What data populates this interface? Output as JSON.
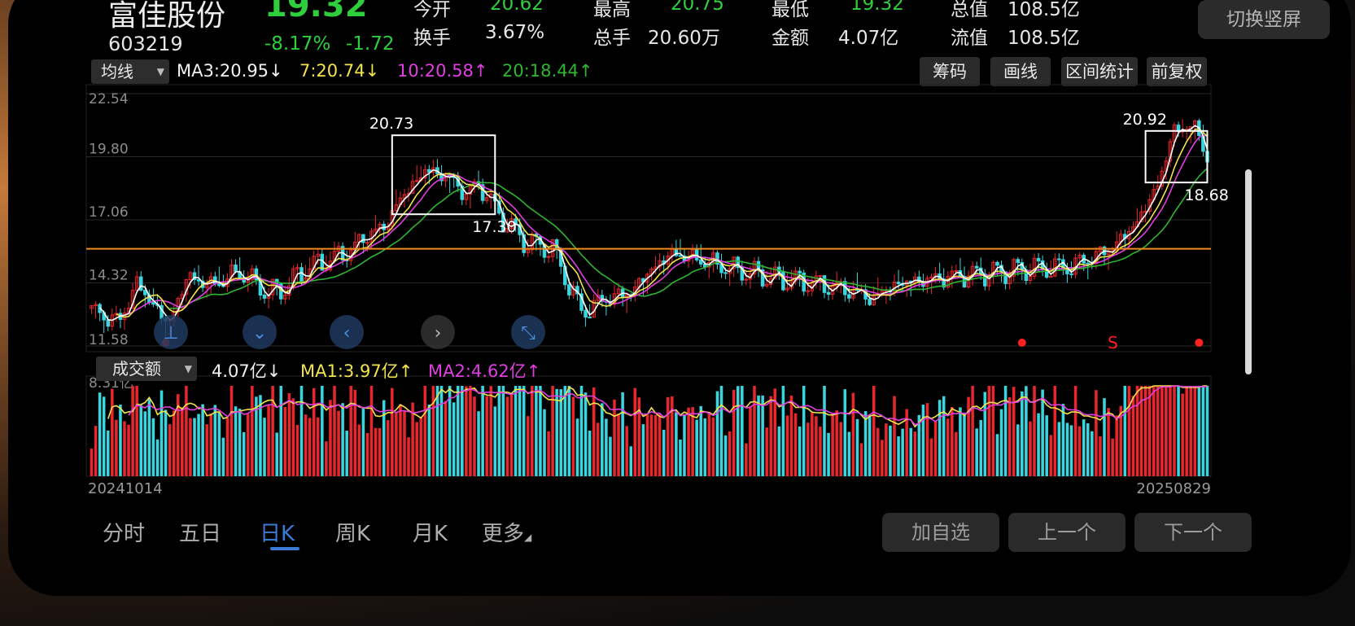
{
  "header": {
    "name": "富佳股份",
    "price": "19.32",
    "code": "603219",
    "change_pct": "-8.17%",
    "change_amt": "-1.72",
    "stats": [
      {
        "label": "今开",
        "value": "20.62",
        "color": "green"
      },
      {
        "label": "最高",
        "value": "20.75",
        "color": "green"
      },
      {
        "label": "最低",
        "value": "19.32",
        "color": "green"
      },
      {
        "label": "总值",
        "value": "108.5亿",
        "color": "white"
      },
      {
        "label": "换手",
        "value": "3.67%",
        "color": "white"
      },
      {
        "label": "总手",
        "value": "20.60万",
        "color": "white"
      },
      {
        "label": "金额",
        "value": "4.07亿",
        "color": "white"
      },
      {
        "label": "流值",
        "value": "108.5亿",
        "color": "white"
      }
    ],
    "switch_label": "切换竖屏"
  },
  "toolbar": {
    "ma_select": "均线",
    "ma3": "MA3:20.95",
    "ma7": "7:20.74",
    "ma10": "10:20.58",
    "ma20": "20:18.44",
    "arrow_down": "↓",
    "arrow_up": "↑",
    "btn_chips": "筹码",
    "btn_draw": "画线",
    "btn_stats": "区间统计",
    "btn_adjust": "前复权"
  },
  "chart_data": {
    "type": "candlestick",
    "y_ticks": [
      "22.54",
      "19.80",
      "17.06",
      "14.32",
      "11.58"
    ],
    "ylim": [
      11.58,
      22.54
    ],
    "reference_line": 15.8,
    "box_labels": [
      "20.73",
      "17.30",
      "20.92",
      "18.68"
    ],
    "signal_label": "S",
    "start_date": "20241014",
    "end_date": "20250829",
    "volume": {
      "select": "成交额",
      "value": "4.07亿",
      "ma1": "MA1:3.97亿",
      "ma2": "MA2:4.62亿",
      "max_label": "8.31亿"
    },
    "colors": {
      "up": "#e8262b",
      "down": "#3ad6e0",
      "ma3": "#ffffff",
      "ma7": "#f2e44a",
      "ma10": "#e03ee0",
      "ma20": "#2fb52f",
      "ref": "#f08a1e"
    }
  },
  "periods": [
    "分时",
    "五日",
    "日K",
    "周K",
    "月K",
    "更多"
  ],
  "bottom_buttons": {
    "add": "加自选",
    "prev": "上一个",
    "next": "下一个"
  }
}
